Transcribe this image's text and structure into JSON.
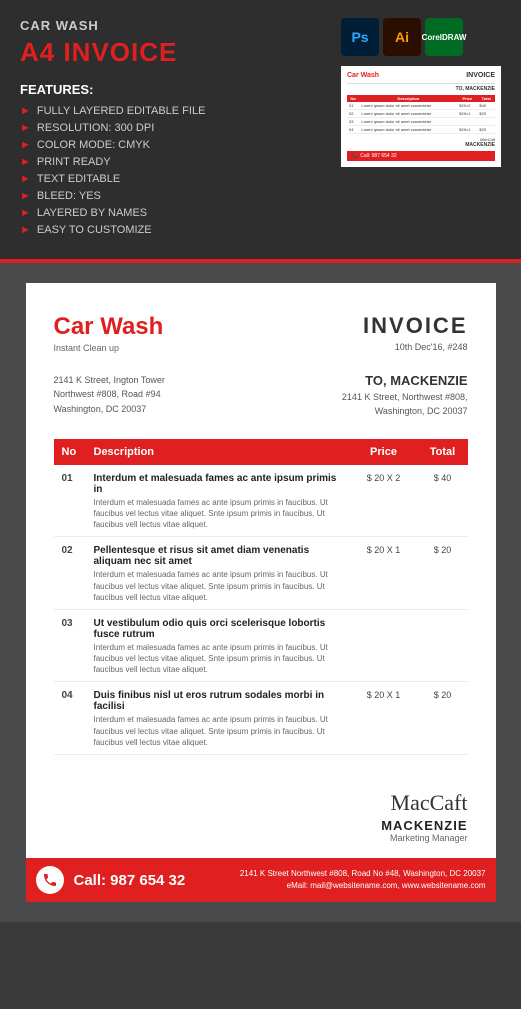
{
  "header": {
    "category": "CAR WASH",
    "title": "A4 INVOICE",
    "features_heading": "FEATURES:",
    "features": [
      "FULLY LAYERED EDITABLE FILE",
      "RESOLUTION: 300 DPI",
      "COLOR MODE: CMYK",
      "PRINT READY",
      "TEXT EDITABLE",
      "BLEED: YES",
      "LAYERED BY NAMES",
      "EASY TO CUSTOMIZE"
    ],
    "software": [
      {
        "label": "Ps",
        "type": "ps"
      },
      {
        "label": "Ai",
        "type": "ai"
      },
      {
        "label": "Cd",
        "type": "cd"
      }
    ]
  },
  "invoice": {
    "brand": "Car Wash",
    "brand_sub": "Instant Clean up",
    "title": "INVOICE",
    "date": "10th Dec'16, #248",
    "from_address": "2141 K Street, Ington Tower\nNorthwest #808, Road #94\nWashington, DC 20037",
    "to_label": "TO, MACKENZIE",
    "to_address": "2141 K Street, Northwest #808,\nWashington, DC 20037",
    "table": {
      "headers": [
        "No",
        "Description",
        "Price",
        "Total"
      ],
      "rows": [
        {
          "no": "01",
          "title": "Interdum et malesuada fames ac ante ipsum primis in",
          "desc": "Interdum et malesuada fames ac ante ipsum primis in faucibus. Ut faucibus vel lectus vitae aliquet. Snte ipsum primis in faucibus. Ut faucibus vell lectus vitae aliquet.",
          "price": "$ 20 X 2",
          "total": "$ 40"
        },
        {
          "no": "02",
          "title": "Pellentesque et risus sit amet diam venenatis aliquam nec sit amet",
          "desc": "Interdum et malesuada fames ac ante ipsum primis in faucibus. Ut faucibus vel lectus vitae aliquet. Snte ipsum primis in faucibus. Ut faucibus vell lectus vitae aliquet.",
          "price": "$ 20 X 1",
          "total": "$ 20"
        },
        {
          "no": "03",
          "title": "Ut vestibulum odio quis orci scelerisque lobortis fusce rutrum",
          "desc": "Interdum et malesuada fames ac ante ipsum primis in faucibus. Ut faucibus vel lectus vitae aliquet. Snte ipsum primis in faucibus. Ut faucibus vell lectus vitae aliquet.",
          "price": "",
          "total": ""
        },
        {
          "no": "04",
          "title": "Duis finibus nisl ut eros rutrum sodales morbi in facilisi",
          "desc": "Interdum et malesuada fames ac ante ipsum primis in faucibus. Ut faucibus vel lectus vitae aliquet. Snte ipsum primis in faucibus. Ut faucibus vell lectus vitae aliquet.",
          "price": "$ 20 X 1",
          "total": "$ 20"
        }
      ]
    },
    "signature_cursive": "MacCaft",
    "signature_name": "MACKENZIE",
    "signature_title": "Marketing Manager",
    "footer_phone": "Call: 987 654 32",
    "footer_address": "2141 K Street Northwest #808,  Road No #48, Washington, DC 20037",
    "footer_email": "eMail: mail@websitename.com, www.websitename.com"
  }
}
